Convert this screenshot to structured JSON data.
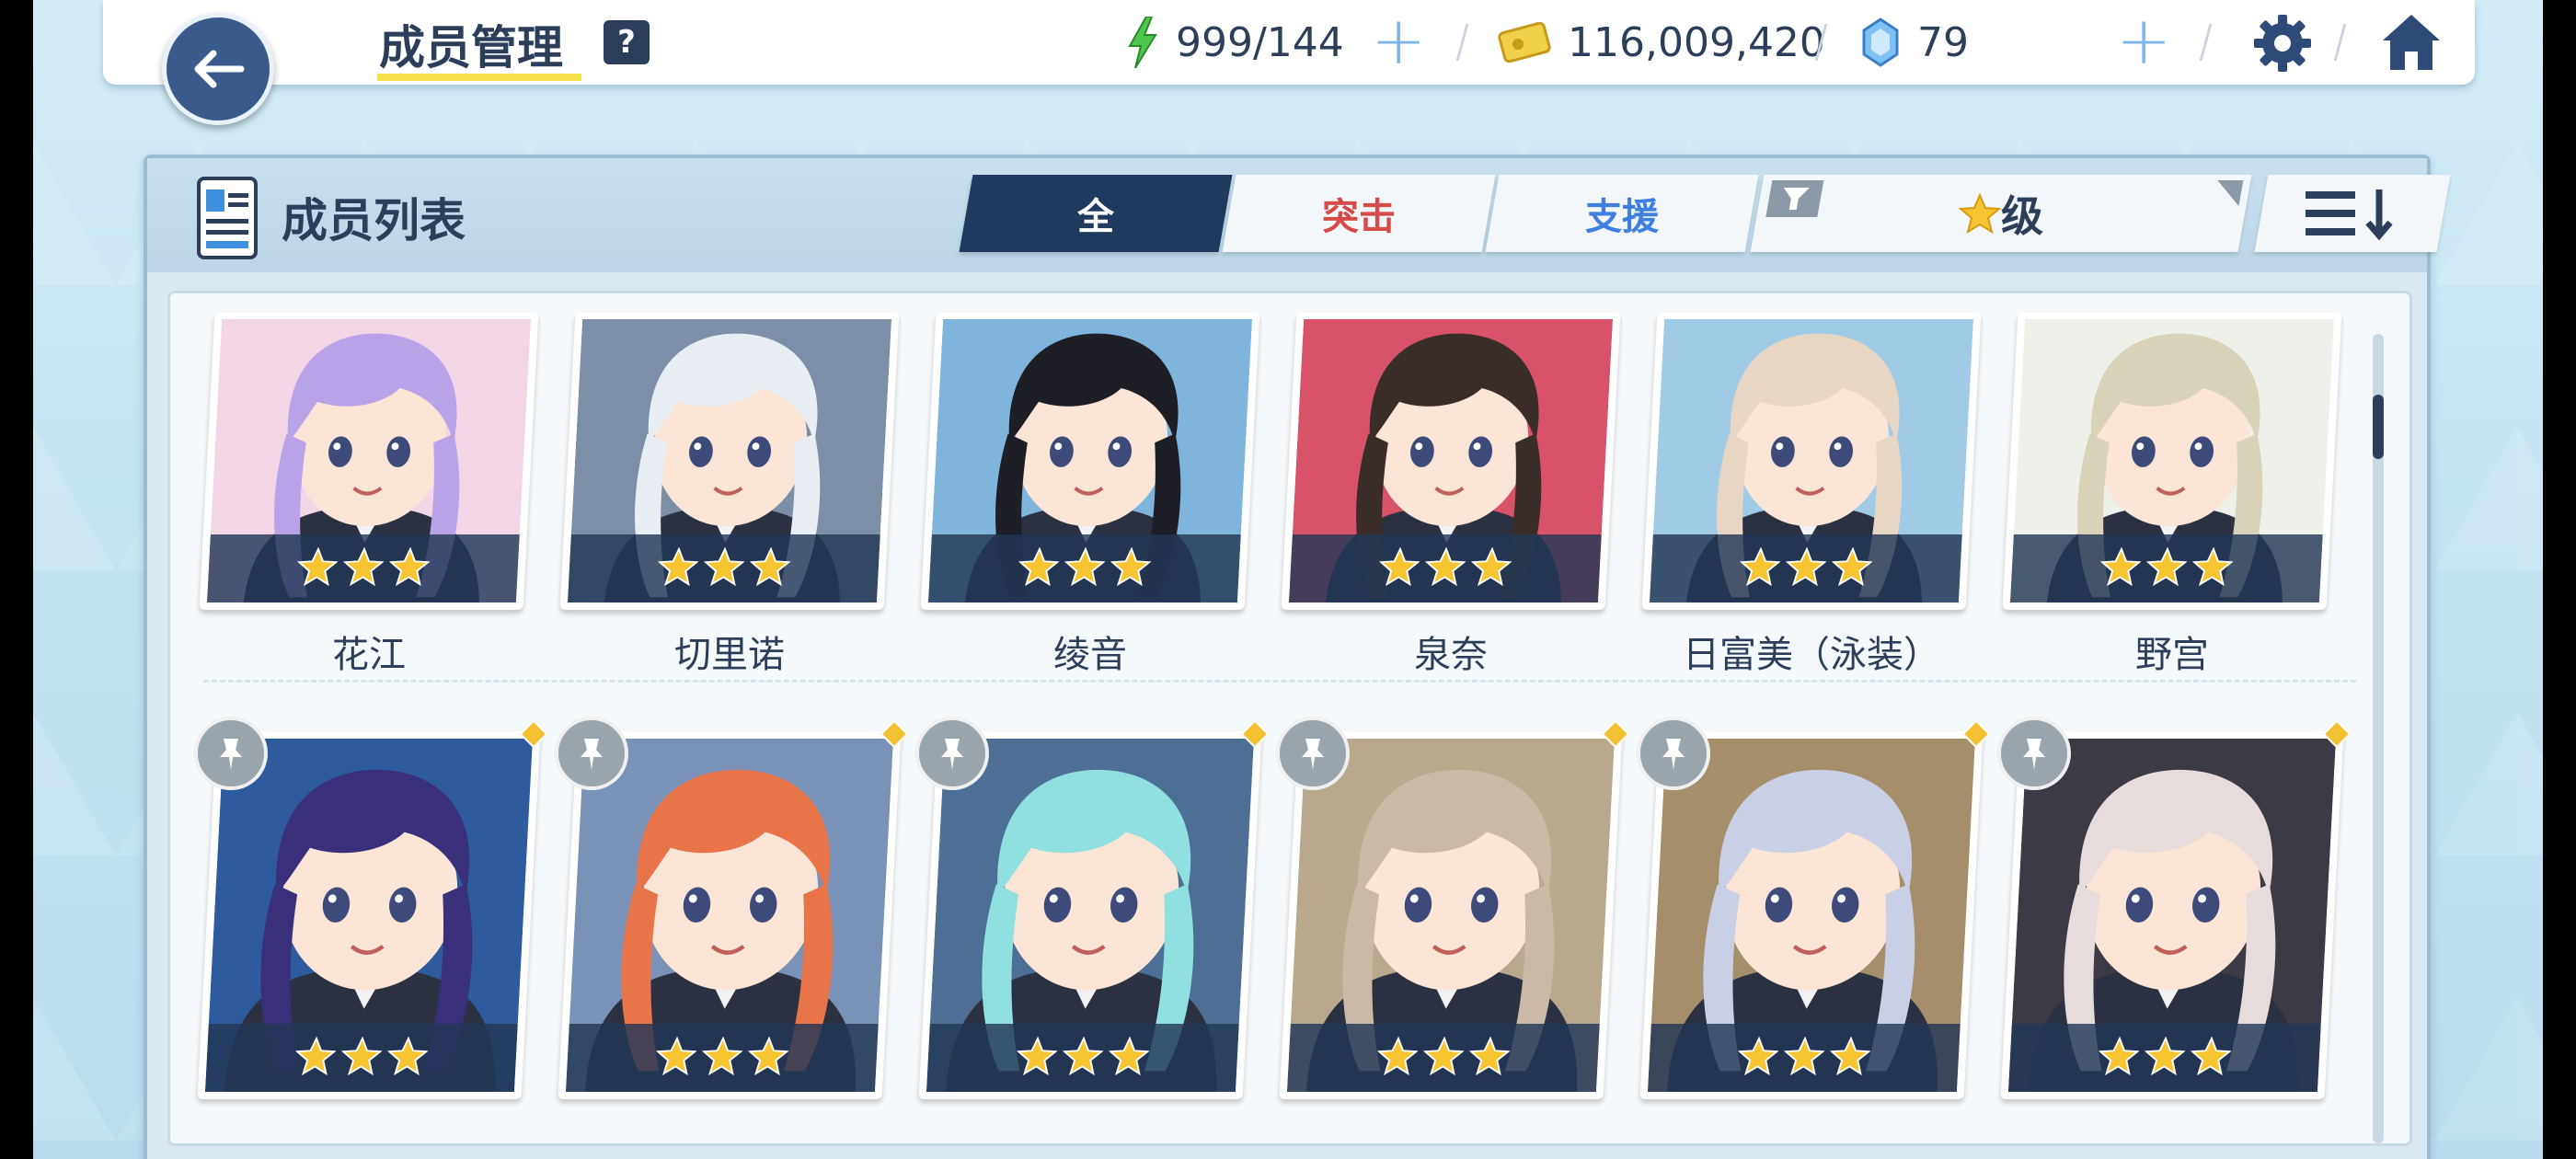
{
  "header": {
    "title": "成员管理",
    "help_label": "?",
    "energy": "999/144",
    "credits": "116,009,420",
    "gems": "79",
    "plus_label": "+"
  },
  "panel": {
    "title": "成员列表",
    "tabs": [
      {
        "label": "全",
        "active": true
      },
      {
        "label": "突击",
        "active": false
      },
      {
        "label": "支援",
        "active": false
      }
    ],
    "filter_label": "级"
  },
  "members_row1": [
    {
      "name": "花江",
      "stars": 3,
      "hair": "#b8a2e8",
      "bg": "#f3d6e6"
    },
    {
      "name": "切里诺",
      "stars": 3,
      "hair": "#e8eef4",
      "bg": "#7d8fa6"
    },
    {
      "name": "绫音",
      "stars": 3,
      "hair": "#1e1e26",
      "bg": "#7fb4dc"
    },
    {
      "name": "泉奈",
      "stars": 3,
      "hair": "#3a2c28",
      "bg": "#d8536a"
    },
    {
      "name": "日富美（泳装）",
      "stars": 3,
      "hair": "#e8d6c4",
      "bg": "#9fcbe6"
    },
    {
      "name": "野宫",
      "stars": 3,
      "hair": "#d8d2b8",
      "bg": "#eef0ea"
    }
  ],
  "members_row2": [
    {
      "stars": 3,
      "hair": "#3a2f7a",
      "bg": "#2e5a9e"
    },
    {
      "stars": 3,
      "hair": "#e8754a",
      "bg": "#7a92b8"
    },
    {
      "stars": 3,
      "hair": "#8fe0df",
      "bg": "#4d6f96"
    },
    {
      "stars": 3,
      "hair": "#c9b9a6",
      "bg": "#b8a88e"
    },
    {
      "stars": 3,
      "hair": "#c9cfe4",
      "bg": "#a48f6a"
    },
    {
      "stars": 3,
      "hair": "#e6dcdc",
      "bg": "#3c3a44"
    }
  ],
  "colors": {
    "navy": "#1f3a5e",
    "assault": "#d64a4a",
    "support": "#3f7fe0",
    "star": "#f7c531"
  }
}
